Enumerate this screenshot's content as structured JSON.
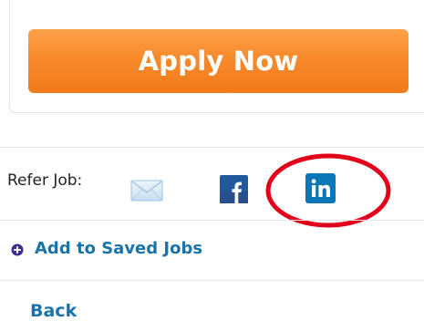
{
  "apply": {
    "label": "Apply Now"
  },
  "refer": {
    "label": "Refer Job:",
    "icons": [
      "mail-icon",
      "facebook-icon",
      "linkedin-icon"
    ],
    "facebook_color": "#215a9c",
    "linkedin_color": "#0b77b7"
  },
  "saved_jobs": {
    "label": "Add to Saved Jobs",
    "icon": "plus-icon",
    "icon_color": "#3b2c96"
  },
  "back": {
    "label": "Back"
  },
  "colors": {
    "apply_button": "#f78a2c",
    "link": "#1a73a8",
    "highlight": "#e3001b"
  }
}
